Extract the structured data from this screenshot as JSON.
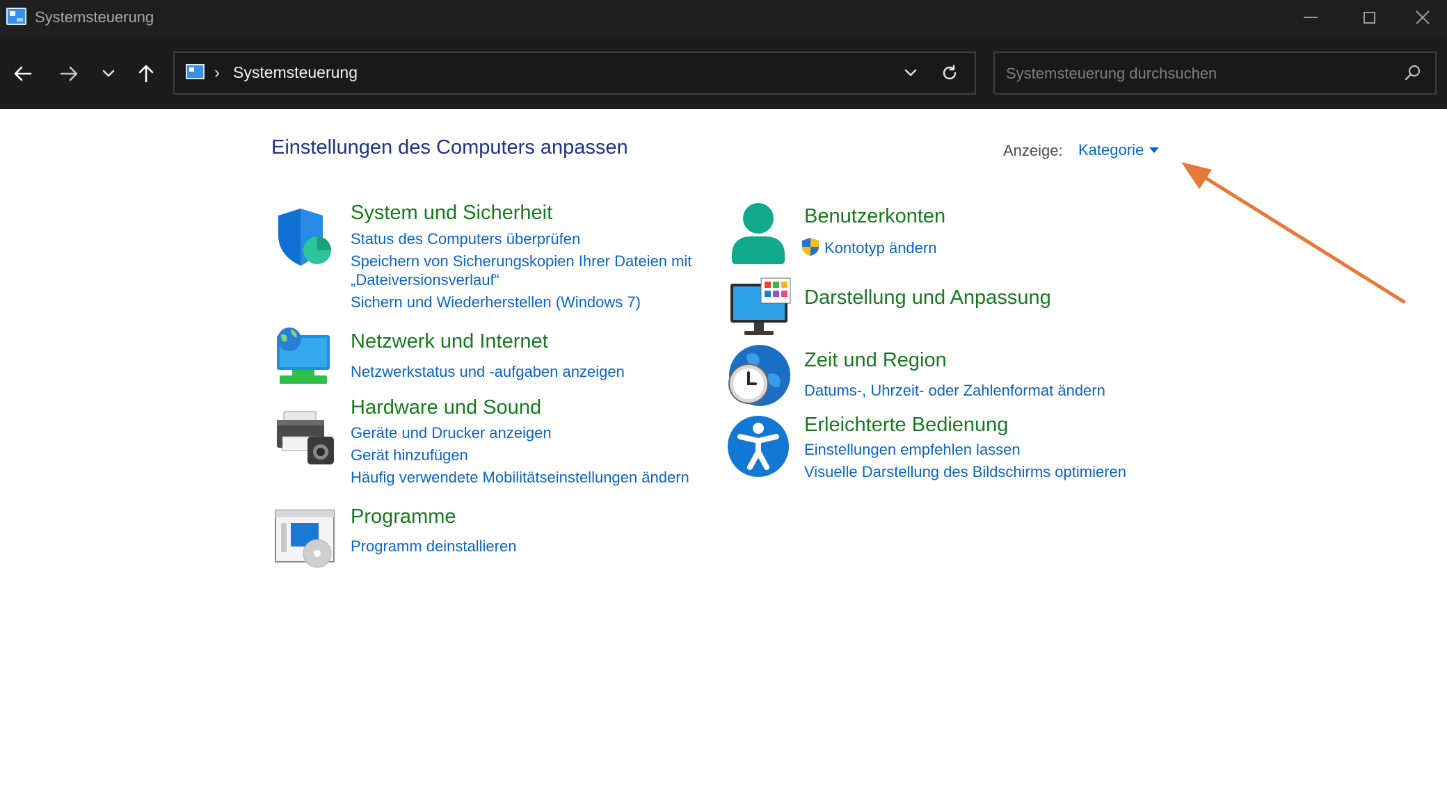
{
  "window": {
    "title": "Systemsteuerung",
    "controls": [
      "minimize",
      "maximize",
      "close"
    ]
  },
  "nav": {
    "back_icon": "arrow-left-icon",
    "forward_icon": "arrow-right-icon",
    "recent_icon": "chevron-down-icon",
    "up_icon": "arrow-up-icon"
  },
  "address": {
    "icon": "control-panel-icon",
    "separator": "›",
    "path": "Systemsteuerung"
  },
  "search": {
    "placeholder": "Systemsteuerung durchsuchen"
  },
  "header": {
    "title": "Einstellungen des Computers anpassen",
    "view_label": "Anzeige:",
    "view_value": "Kategorie"
  },
  "categories": {
    "system": {
      "title": "System und Sicherheit",
      "icon": "security-shield-icon",
      "links": [
        "Status des Computers überprüfen",
        "Speichern von Sicherungskopien Ihrer Dateien mit",
        "„Dateiversionsverlauf“",
        "Sichern und Wiederherstellen (Windows 7)"
      ]
    },
    "network": {
      "title": "Netzwerk und Internet",
      "icon": "network-globe-icon",
      "links": [
        "Netzwerkstatus und -aufgaben anzeigen"
      ]
    },
    "hardware": {
      "title": "Hardware und Sound",
      "icon": "printer-icon",
      "links": [
        "Geräte und Drucker anzeigen",
        "Gerät hinzufügen",
        "Häufig verwendete Mobilitätseinstellungen ändern"
      ]
    },
    "programs": {
      "title": "Programme",
      "icon": "programs-icon",
      "links": [
        "Programm deinstallieren"
      ]
    },
    "users": {
      "title": "Benutzerkonten",
      "icon": "user-icon",
      "links": [
        "Kontotyp ändern"
      ]
    },
    "appearance": {
      "title": "Darstellung und Anpassung",
      "icon": "monitor-icon",
      "links": []
    },
    "region": {
      "title": "Zeit und Region",
      "icon": "clock-globe-icon",
      "links": [
        "Datums-, Uhrzeit- oder Zahlenformat ändern"
      ]
    },
    "accessibility": {
      "title": "Erleichterte Bedienung",
      "icon": "accessibility-icon",
      "links": [
        "Einstellungen empfehlen lassen",
        "Visuelle Darstellung des Bildschirms optimieren"
      ]
    }
  },
  "colors": {
    "titlebar": "#1f1f1f",
    "navbar": "#1c1c1c",
    "category_title": "#17791d",
    "link": "#0a63c9",
    "page_title": "#1e3287",
    "annotation_arrow": "#e8773a"
  }
}
